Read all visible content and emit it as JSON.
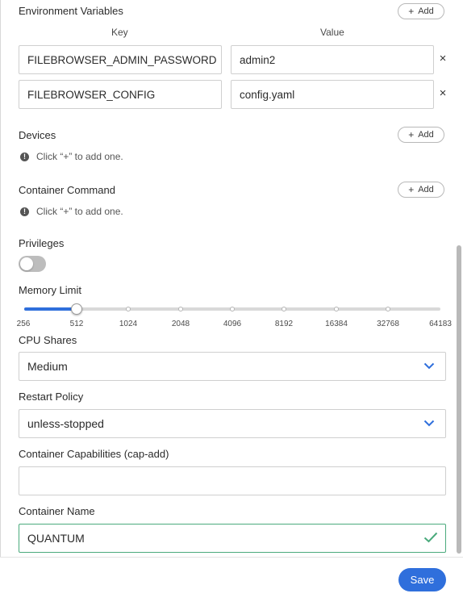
{
  "env": {
    "title": "Environment Variables",
    "add_label": "Add",
    "key_header": "Key",
    "value_header": "Value",
    "rows": [
      {
        "key": "FILEBROWSER_ADMIN_PASSWORD",
        "value": "admin2"
      },
      {
        "key": "FILEBROWSER_CONFIG",
        "value": "config.yaml"
      }
    ],
    "remove_glyph": "×"
  },
  "devices": {
    "title": "Devices",
    "add_label": "Add",
    "hint": "Click “+” to add one."
  },
  "command": {
    "title": "Container Command",
    "add_label": "Add",
    "hint": "Click “+” to add one."
  },
  "privileges": {
    "title": "Privileges",
    "enabled": false
  },
  "memory": {
    "title": "Memory Limit",
    "ticks": [
      "256",
      "512",
      "1024",
      "2048",
      "4096",
      "8192",
      "16384",
      "32768",
      "64183"
    ],
    "selected_index": 1
  },
  "cpu": {
    "title": "CPU Shares",
    "value": "Medium"
  },
  "restart": {
    "title": "Restart Policy",
    "value": "unless-stopped"
  },
  "capabilities": {
    "title": "Container Capabilities (cap-add)",
    "value": ""
  },
  "name": {
    "title": "Container Name",
    "value": "QUANTUM"
  },
  "footer": {
    "save_label": "Save"
  },
  "colors": {
    "accent": "#2f6fdc",
    "valid": "#4aaa7c"
  }
}
